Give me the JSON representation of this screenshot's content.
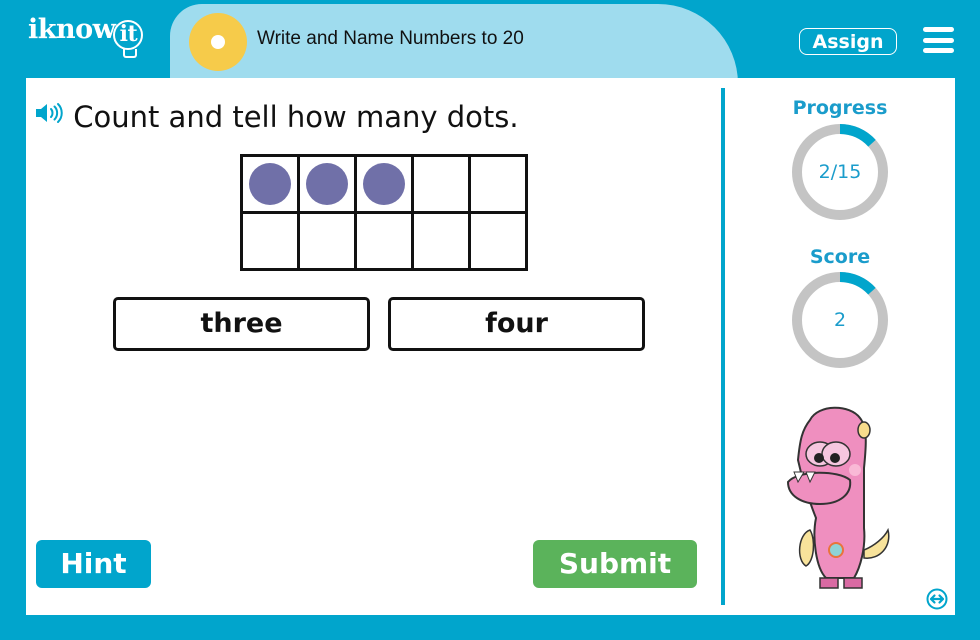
{
  "header": {
    "logo_text": "iknow",
    "logo_bulb_text": "it",
    "lesson_title": "Write and Name Numbers to 20",
    "assign_label": "Assign",
    "menu_icon": "hamburger-menu-icon"
  },
  "question": {
    "speaker_icon": "speaker-icon",
    "prompt": "Count and tell how many dots.",
    "ten_frame": {
      "rows": 2,
      "columns": 5,
      "filled_count": 3,
      "counter_color": "#7070a8"
    }
  },
  "choices": [
    {
      "label": "three"
    },
    {
      "label": "four"
    }
  ],
  "buttons": {
    "hint_label": "Hint",
    "submit_label": "Submit"
  },
  "sidebar": {
    "progress": {
      "label": "Progress",
      "value_text": "2/15",
      "current": 2,
      "total": 15
    },
    "score": {
      "label": "Score",
      "value_text": "2",
      "fraction": 0.133
    },
    "mascot": "pink-monster-mascot",
    "expand_icon": "expand-horizontal-icon"
  },
  "colors": {
    "brand_blue": "#01a5cc",
    "title_band": "#9fdcee",
    "sun_yellow": "#f6cb4a",
    "submit_green": "#5bb35b",
    "ring_track": "#c4c4c4",
    "ring_fill": "#01a5cc"
  }
}
